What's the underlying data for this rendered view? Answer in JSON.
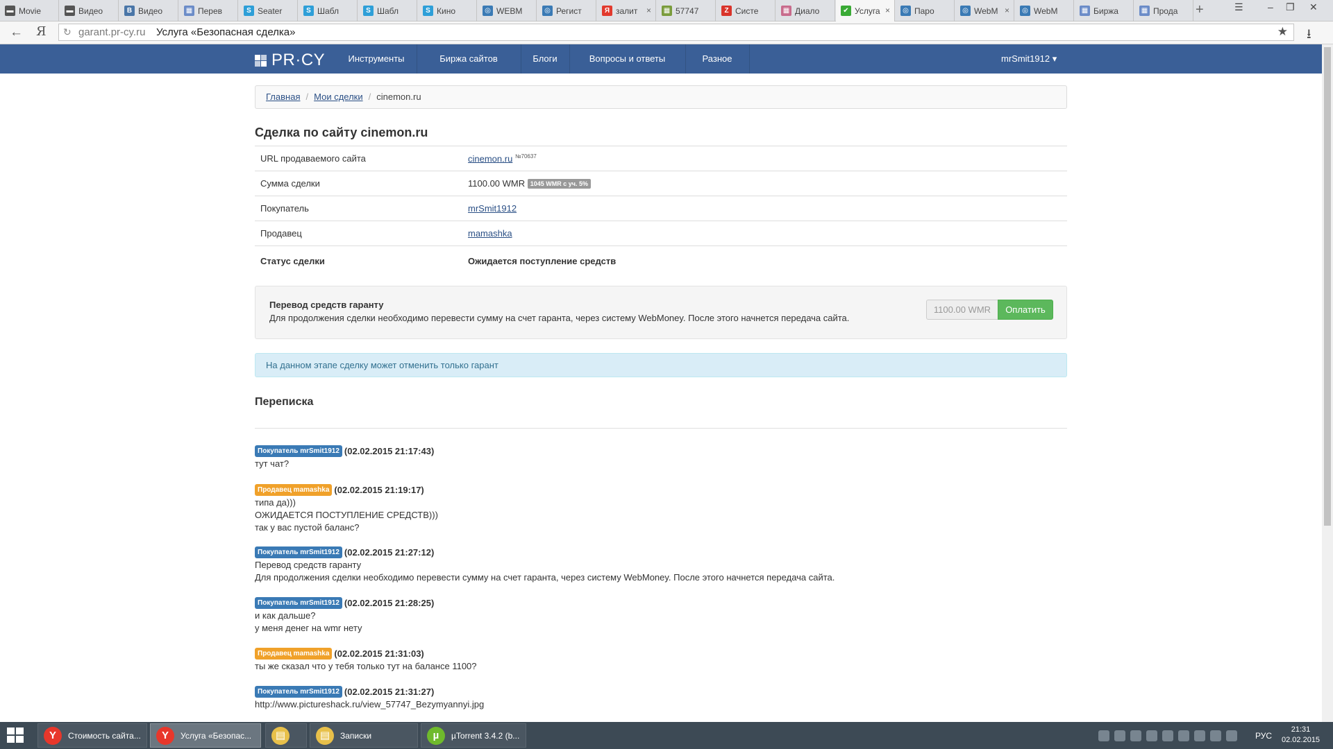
{
  "browser": {
    "tabs": [
      {
        "label": "Movie",
        "favicon_color": "#555555",
        "favicon_glyph": "▬"
      },
      {
        "label": "Видео",
        "favicon_color": "#555555",
        "favicon_glyph": "▬"
      },
      {
        "label": "Видео",
        "favicon_color": "#4a76a8",
        "favicon_glyph": "В"
      },
      {
        "label": "Перев",
        "favicon_color": "#6b8cc8",
        "favicon_glyph": "▦"
      },
      {
        "label": "Seater",
        "favicon_color": "#2e9fd8",
        "favicon_glyph": "S"
      },
      {
        "label": "Шабл",
        "favicon_color": "#2e9fd8",
        "favicon_glyph": "S"
      },
      {
        "label": "Шабл",
        "favicon_color": "#2e9fd8",
        "favicon_glyph": "S"
      },
      {
        "label": "Кино",
        "favicon_color": "#2e9fd8",
        "favicon_glyph": "S"
      },
      {
        "label": "WEBM",
        "favicon_color": "#3a7ab5",
        "favicon_glyph": "◎"
      },
      {
        "label": "Регист",
        "favicon_color": "#3a7ab5",
        "favicon_glyph": "◎"
      },
      {
        "label": "залит",
        "favicon_color": "#e23a2e",
        "favicon_glyph": "Я"
      },
      {
        "label": "57747",
        "favicon_color": "#7a9c3c",
        "favicon_glyph": "▦"
      },
      {
        "label": "Систе",
        "favicon_color": "#d9342b",
        "favicon_glyph": "Z"
      },
      {
        "label": "Диало",
        "favicon_color": "#c86b8c",
        "favicon_glyph": "▦"
      },
      {
        "label": "Услуга",
        "favicon_color": "#3aaa35",
        "favicon_glyph": "✔"
      },
      {
        "label": "Паро",
        "favicon_color": "#3a7ab5",
        "favicon_glyph": "◎"
      },
      {
        "label": "WebM",
        "favicon_color": "#3a7ab5",
        "favicon_glyph": "◎"
      },
      {
        "label": "WebM",
        "favicon_color": "#3a7ab5",
        "favicon_glyph": "◎"
      },
      {
        "label": "Биржа",
        "favicon_color": "#6b8cc8",
        "favicon_glyph": "▦"
      },
      {
        "label": "Прода",
        "favicon_color": "#6b8cc8",
        "favicon_glyph": "▦"
      }
    ],
    "active_tab_index": 14,
    "new_tab_glyph": "+",
    "url_host": "garant.pr-cy.ru",
    "page_title": "Услуга «Безопасная сделка»",
    "back_glyph": "←",
    "yandex_glyph": "Я"
  },
  "site": {
    "logo_text": "PR·CY",
    "nav": [
      "Инструменты",
      "Биржа сайтов",
      "Блоги",
      "Вопросы и ответы",
      "Разное"
    ],
    "user_menu": "mrSmit1912 ▾"
  },
  "breadcrumb": {
    "home": "Главная",
    "deals": "Мои сделки",
    "current": "cinemon.ru",
    "separator": "/"
  },
  "deal": {
    "title": "Сделка по сайту cinemon.ru",
    "rows": {
      "url_label": "URL продаваемого сайта",
      "url_value": "cinemon.ru",
      "url_id": "№70637",
      "sum_label": "Сумма сделки",
      "sum_value": "1100.00 WMR",
      "sum_badge": "1045 WMR с уч. 5%",
      "buyer_label": "Покупатель",
      "buyer_value": "mrSmit1912",
      "seller_label": "Продавец",
      "seller_value": "mamashka",
      "status_label": "Статус сделки",
      "status_value": "Ожидается поступление средств"
    }
  },
  "transfer": {
    "title": "Перевод средств гаранту",
    "description": "Для продолжения сделки необходимо перевести сумму на счет гаранта, через систему WebMoney. После этого начнется передача сайта.",
    "amount_placeholder": "1100.00 WMR",
    "pay_button": "Оплатить"
  },
  "alert_text": "На данном этапе сделку может отменить только гарант",
  "correspondence": {
    "title": "Переписка",
    "messages": [
      {
        "role": "buyer",
        "badge": "Покупатель mrSmit1912",
        "time": "(02.02.2015 21:17:43)",
        "lines": [
          "тут чат?"
        ]
      },
      {
        "role": "seller",
        "badge": "Продавец mamashka",
        "time": "(02.02.2015 21:19:17)",
        "lines": [
          "типа да)))",
          "ОЖИДАЕТСЯ ПОСТУПЛЕНИЕ СРЕДСТВ)))",
          "так у вас пустой баланс?"
        ]
      },
      {
        "role": "buyer",
        "badge": "Покупатель mrSmit1912",
        "time": "(02.02.2015 21:27:12)",
        "lines": [
          "Перевод средств гаранту",
          "Для продолжения сделки необходимо перевести сумму на счет гаранта, через систему WebMoney. После этого начнется передача сайта."
        ]
      },
      {
        "role": "buyer",
        "badge": "Покупатель mrSmit1912",
        "time": "(02.02.2015 21:28:25)",
        "lines": [
          "и как дальше?",
          "у меня денег на wmr нету"
        ]
      },
      {
        "role": "seller",
        "badge": "Продавец mamashka",
        "time": "(02.02.2015 21:31:03)",
        "lines": [
          "ты же сказал что у тебя только тут на балансе 1100?"
        ]
      },
      {
        "role": "buyer",
        "badge": "Покупатель mrSmit1912",
        "time": "(02.02.2015 21:31:27)",
        "lines": [
          "http://www.pictureshack.ru/view_57747_Bezymyannyi.jpg"
        ]
      }
    ]
  },
  "taskbar": {
    "buttons": [
      {
        "label": "Стоимость сайта...",
        "icon": "yandex-browser-icon",
        "icon_glyph": "Y",
        "icon_color": "#e8372b",
        "active": false
      },
      {
        "label": "Услуга «Безопас...",
        "icon": "yandex-browser-icon",
        "icon_glyph": "Y",
        "icon_color": "#e8372b",
        "active": true
      },
      {
        "label": "",
        "icon": "file-explorer-icon",
        "icon_glyph": "▤",
        "icon_color": "#e8c04a",
        "active": false
      },
      {
        "label": "Записки",
        "icon": "folder-icon",
        "icon_glyph": "▤",
        "icon_color": "#e8c04a",
        "active": false
      },
      {
        "label": "µTorrent 3.4.2  (b...",
        "icon": "utorrent-icon",
        "icon_glyph": "µ",
        "icon_color": "#6fba2c",
        "active": false
      }
    ],
    "language": "РУС",
    "time": "21:31",
    "date": "02.02.2015"
  }
}
